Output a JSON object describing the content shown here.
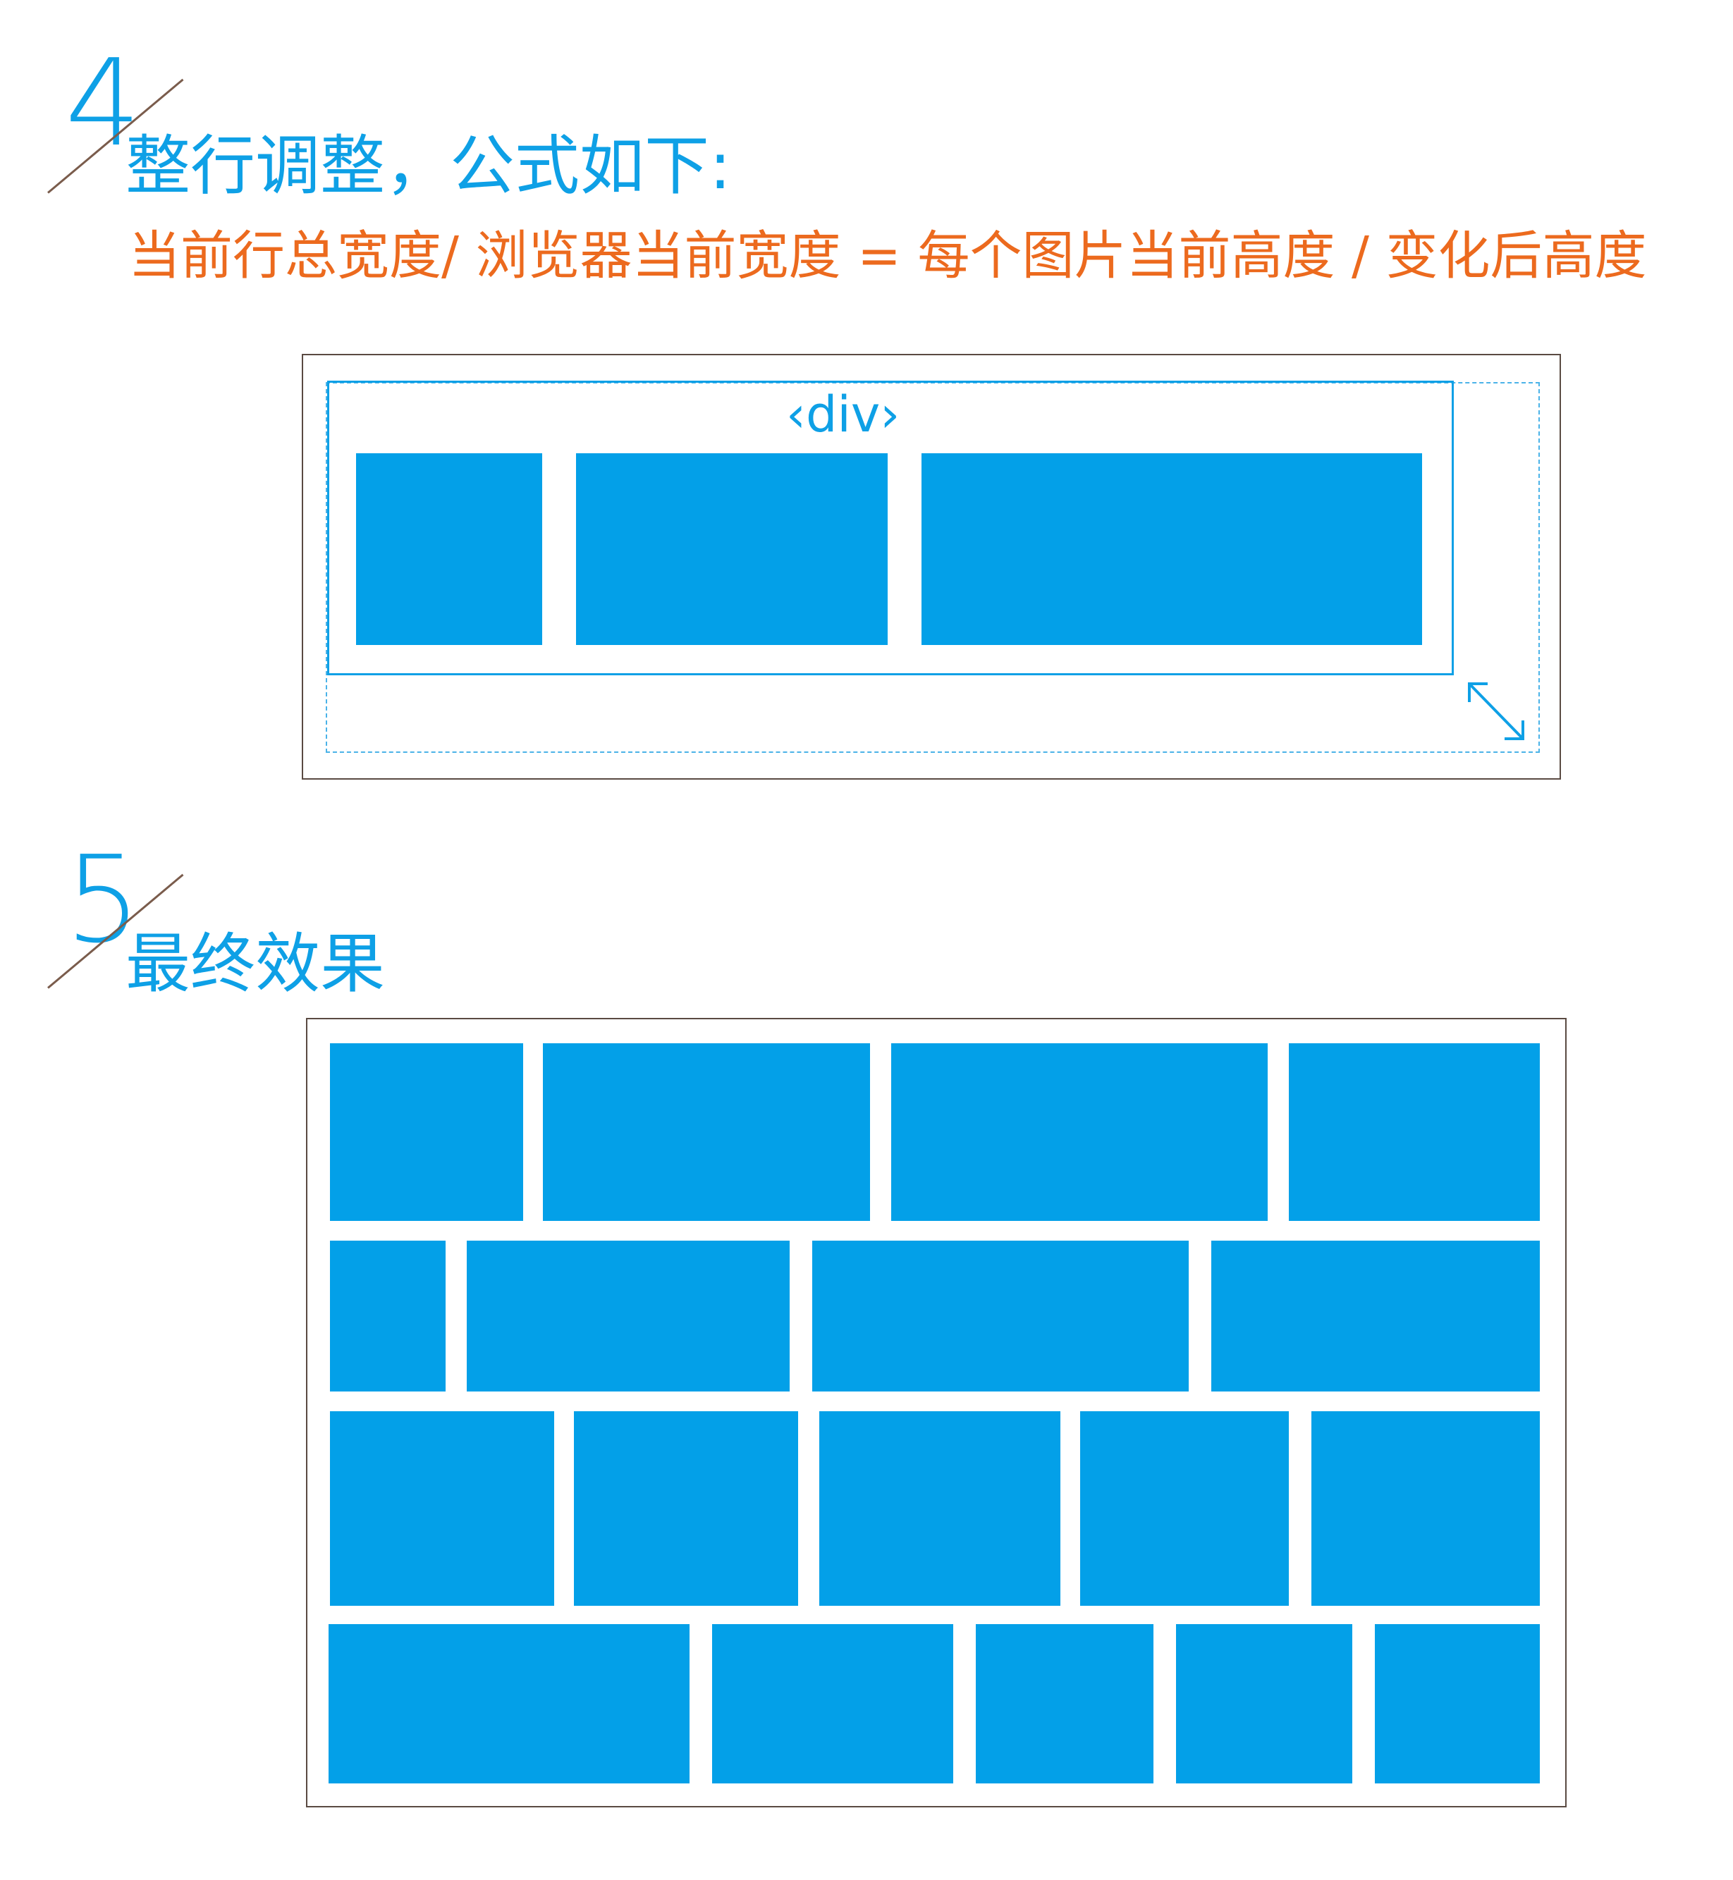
{
  "step4": {
    "number": "4",
    "title": "整行调整，公式如下:",
    "formula": "当前行总宽度/ 浏览器当前宽度 = 每个图片当前高度 / 变化后高度",
    "div_label": "‹div›"
  },
  "step5": {
    "number": "5",
    "title": "最终效果"
  },
  "colors": {
    "accent_blue": "#03a0e8",
    "formula_orange": "#ec6a1e",
    "frame_brown": "#5a4a42"
  },
  "icons": [
    "resize-arrow-icon"
  ]
}
